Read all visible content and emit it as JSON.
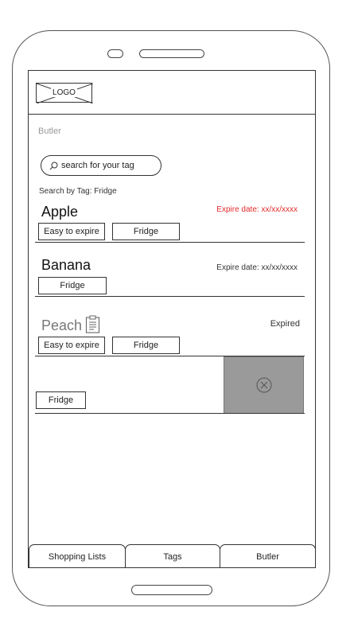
{
  "header": {
    "logo_text": "LOGO"
  },
  "app": {
    "title": "Butler"
  },
  "search": {
    "placeholder": "search for your tag"
  },
  "filter": {
    "label": "Search by Tag: Fridge"
  },
  "items": [
    {
      "name": "Apple",
      "expire": "Expire date: xx/xx/xxxx",
      "expire_color": "#e02b2b",
      "tags": [
        "Easy to expire",
        "Fridge"
      ]
    },
    {
      "name": "Banana",
      "expire": "Expire date: xx/xx/xxxx",
      "expire_color": "#333333",
      "tags": [
        "Fridge"
      ]
    },
    {
      "name": "Peach",
      "expire": "Expired",
      "expire_color": "#333333",
      "icon": "clipboard-icon",
      "tags": [
        "Easy to expire",
        "Fridge"
      ]
    },
    {
      "name": "",
      "tags": [
        "Fridge"
      ],
      "swipe_action_icon": "delete-circle-icon"
    }
  ],
  "tabs": [
    {
      "label": "Shopping Lists"
    },
    {
      "label": "Tags"
    },
    {
      "label": "Butler"
    }
  ],
  "colors": {
    "expire_warning": "#e02b2b",
    "delete_background": "#9a9a9a"
  }
}
